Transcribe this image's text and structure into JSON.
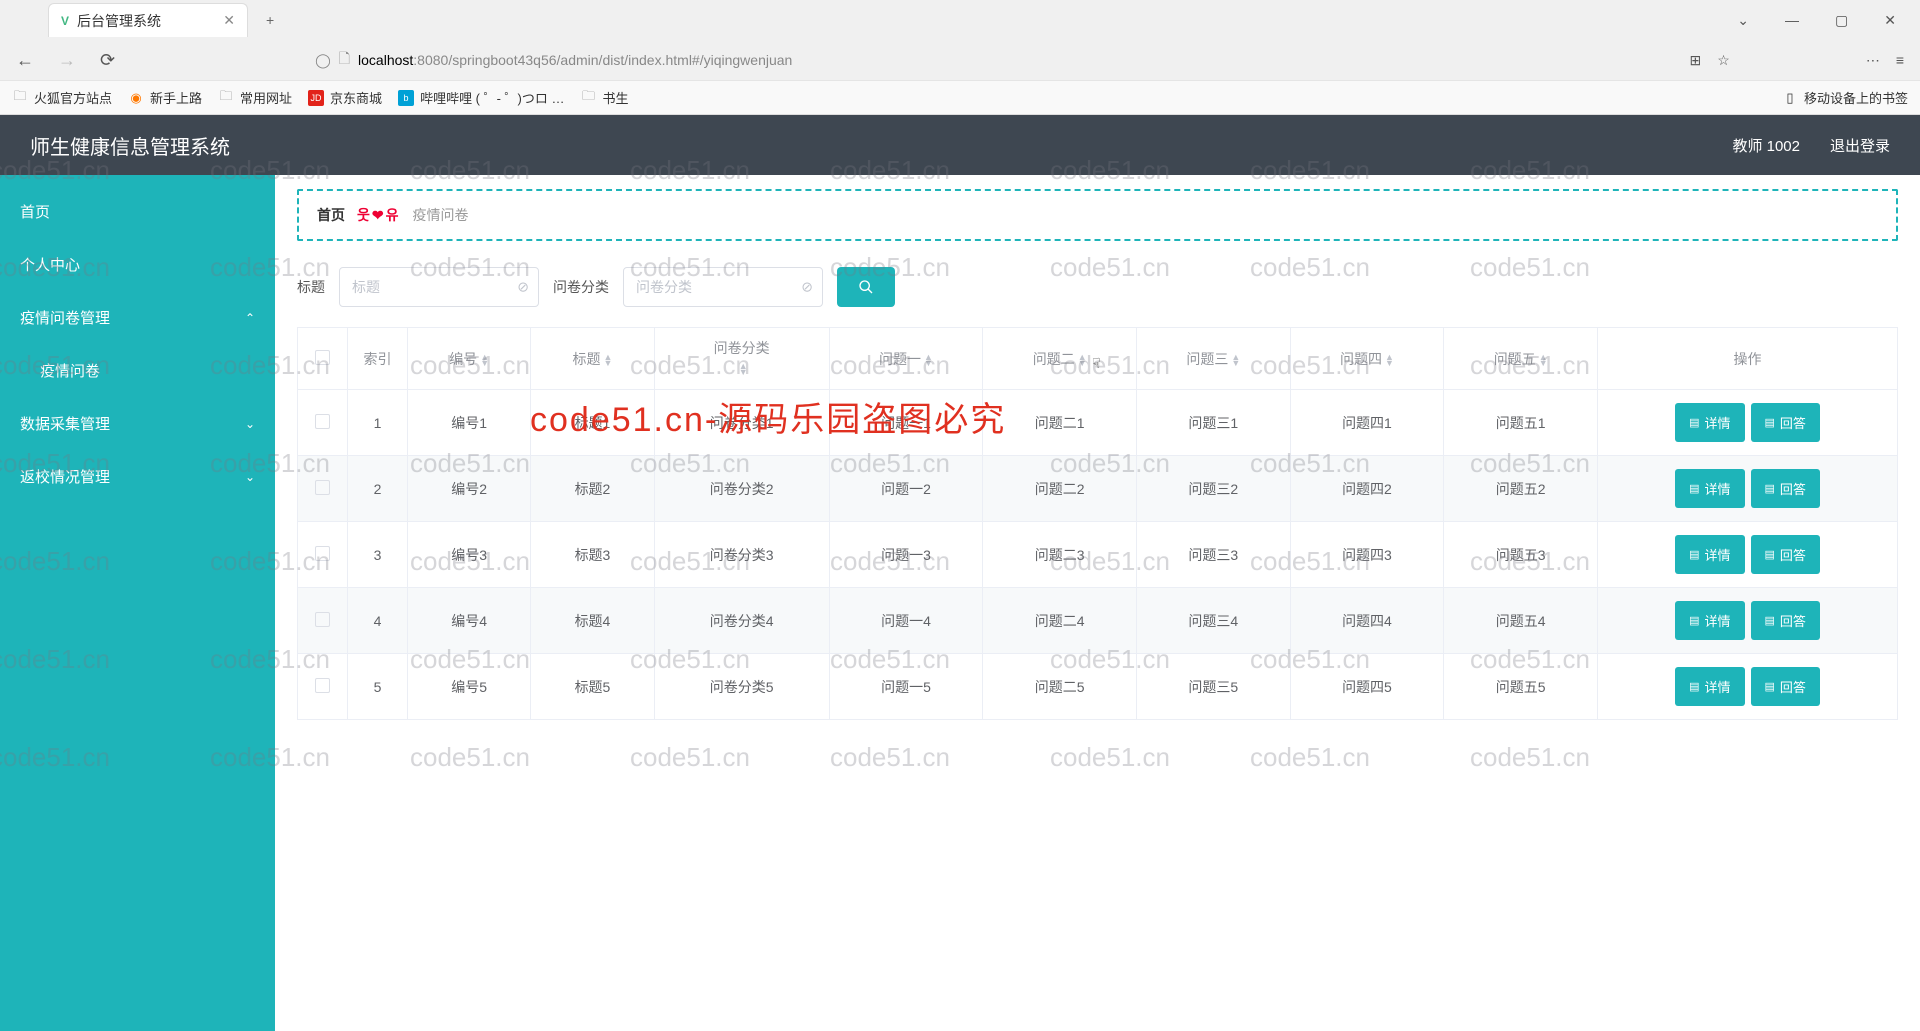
{
  "browser": {
    "tab_title": "后台管理系统",
    "url_host": "localhost",
    "url_rest": ":8080/springboot43q56/admin/dist/index.html#/yiqingwenjuan",
    "bookmarks": {
      "b1": "火狐官方站点",
      "b2": "新手上路",
      "b3": "常用网址",
      "b4": "京东商城",
      "b5": "哔哩哔哩 (  ゜- ゜)つロ …",
      "b6": "书生",
      "right": "移动设备上的书签"
    }
  },
  "header": {
    "title": "师生健康信息管理系统",
    "user": "教师 1002",
    "logout": "退出登录"
  },
  "sidebar": {
    "home": "首页",
    "personal": "个人中心",
    "survey_mgmt": "疫情问卷管理",
    "survey": "疫情问卷",
    "data_collect": "数据采集管理",
    "return_school": "返校情况管理"
  },
  "breadcrumb": {
    "home": "首页",
    "smile": "웃❤유",
    "current": "疫情问卷"
  },
  "filter": {
    "title_label": "标题",
    "title_placeholder": "标题",
    "cat_label": "问卷分类",
    "cat_placeholder": "问卷分类"
  },
  "table": {
    "headers": {
      "index": "索引",
      "code": "编号",
      "title": "标题",
      "cat": "问卷分类",
      "q1": "问题一",
      "q2": "问题二",
      "q3": "问题三",
      "q4": "问题四",
      "q5": "问题五",
      "op": "操作"
    },
    "btn_detail": "详情",
    "btn_answer": "回答",
    "rows": [
      {
        "idx": "1",
        "code": "编号1",
        "title": "标题1",
        "cat": "问卷分类1",
        "q1": "问题一1",
        "q2": "问题二1",
        "q3": "问题三1",
        "q4": "问题四1",
        "q5": "问题五1"
      },
      {
        "idx": "2",
        "code": "编号2",
        "title": "标题2",
        "cat": "问卷分类2",
        "q1": "问题一2",
        "q2": "问题二2",
        "q3": "问题三2",
        "q4": "问题四2",
        "q5": "问题五2"
      },
      {
        "idx": "3",
        "code": "编号3",
        "title": "标题3",
        "cat": "问卷分类3",
        "q1": "问题一3",
        "q2": "问题二3",
        "q3": "问题三3",
        "q4": "问题四3",
        "q5": "问题五3"
      },
      {
        "idx": "4",
        "code": "编号4",
        "title": "标题4",
        "cat": "问卷分类4",
        "q1": "问题一4",
        "q2": "问题二4",
        "q3": "问题三4",
        "q4": "问题四4",
        "q5": "问题五4"
      },
      {
        "idx": "5",
        "code": "编号5",
        "title": "标题5",
        "cat": "问卷分类5",
        "q1": "问题一5",
        "q2": "问题二5",
        "q3": "问题三5",
        "q4": "问题四5",
        "q5": "问题五5"
      }
    ]
  },
  "watermark_text": "code51.cn",
  "watermark_red": "code51.cn-源码乐园盗图必究"
}
